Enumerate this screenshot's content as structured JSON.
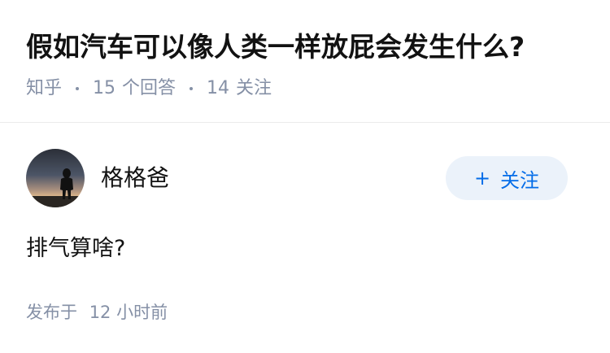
{
  "question": {
    "title": "假如汽车可以像人类一样放屁会发生什么?",
    "source": "知乎",
    "answer_count": "15",
    "answer_label": "个回答",
    "follower_count": "14",
    "follower_label": "关注"
  },
  "answer": {
    "author_name": "格格爸",
    "follow_plus": "+",
    "follow_label": "关注",
    "content": "排气算啥?",
    "time_prefix": "发布于",
    "time_value": "12 小时前"
  },
  "colors": {
    "meta_text": "#8590a6",
    "follow_bg": "#ebf2fa",
    "follow_text": "#056de8"
  },
  "icons": {
    "avatar": "silhouette-at-sunset-avatar"
  }
}
